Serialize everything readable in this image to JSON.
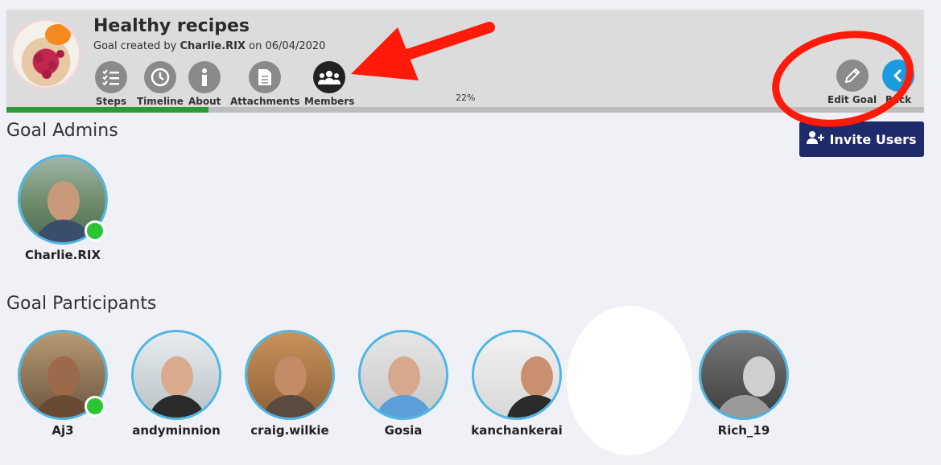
{
  "goal": {
    "title": "Healthy recipes",
    "created_prefix": "Goal created by",
    "creator": "Charlie.RIX",
    "date_prefix": "on",
    "date": "06/04/2020",
    "progress_label": "22%",
    "progress": 0.22
  },
  "nav": [
    {
      "label": "Steps",
      "icon": "checklist-icon"
    },
    {
      "label": "Timeline",
      "icon": "clock-icon"
    },
    {
      "label": "About",
      "icon": "info-icon"
    },
    {
      "label": "Attachments",
      "icon": "document-icon"
    },
    {
      "label": "Members",
      "icon": "group-icon"
    }
  ],
  "actions": {
    "edit_label": "Edit Goal",
    "back_label": "Back",
    "invite_label": "Invite Users"
  },
  "sections": {
    "admins_title": "Goal Admins",
    "participants_title": "Goal Participants"
  },
  "admins": [
    {
      "name": "Charlie.RIX",
      "online": true
    }
  ],
  "participants": [
    {
      "name": "Aj3",
      "online": true
    },
    {
      "name": "andyminnion",
      "online": false
    },
    {
      "name": "craig.wilkie",
      "online": false
    },
    {
      "name": "Gosia",
      "online": false
    },
    {
      "name": "kanchankerai",
      "online": false
    },
    {
      "name": "Rich_19",
      "online": false
    }
  ],
  "colors": {
    "progress_fill": "#2e9a3c",
    "invite_bg": "#1f2a6a",
    "avatar_border": "#4db6e4",
    "online": "#2ac532",
    "annotation_red": "#ff1a0a"
  }
}
